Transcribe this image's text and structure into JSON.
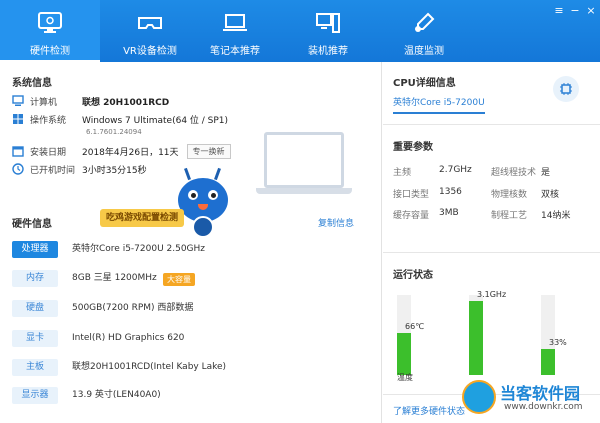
{
  "tabs": [
    {
      "label": "硬件检测",
      "icon": "monitor-icon"
    },
    {
      "label": "VR设备检测",
      "icon": "vr-headset-icon"
    },
    {
      "label": "笔记本推荐",
      "icon": "laptop-icon"
    },
    {
      "label": "装机推荐",
      "icon": "desktop-tower-icon"
    },
    {
      "label": "温度监测",
      "icon": "thermometer-icon"
    }
  ],
  "window": {
    "menu": "≡",
    "minimize": "−",
    "close": "×"
  },
  "system": {
    "title": "系统信息",
    "computer_label": "计算机",
    "computer_value": "联想 20H1001RCD",
    "os_label": "操作系统",
    "os_value": "Windows 7 Ultimate(64 位 / SP1)",
    "os_version": "6.1.7601.24094",
    "install_label": "安装日期",
    "install_value": "2018年4月26日，11天",
    "install_button": "专一换新",
    "uptime_label": "已开机时间",
    "uptime_value": "3小时35分15秒"
  },
  "banner": {
    "text": "吃鸡游戏配置检测"
  },
  "hardware": {
    "title": "硬件信息",
    "link": "复制信息",
    "items": [
      {
        "tag": "处理器",
        "value": "英特尔Core i5-7200U 2.50GHz",
        "badge": ""
      },
      {
        "tag": "内存",
        "value": "8GB 三星 1200MHz",
        "badge": "大容量"
      },
      {
        "tag": "硬盘",
        "value": "500GB(7200 RPM) 西部数据",
        "badge": ""
      },
      {
        "tag": "显卡",
        "value": "Intel(R) HD Graphics 620",
        "badge": ""
      },
      {
        "tag": "主板",
        "value": "联想20H1001RCD(Intel Kaby Lake)",
        "badge": ""
      },
      {
        "tag": "显示器",
        "value": "13.9 英寸(LEN40A0)",
        "badge": ""
      }
    ]
  },
  "cpu": {
    "title": "CPU详细信息",
    "tab": "英特尔Core i5-7200U",
    "params_title": "重要参数",
    "params": [
      {
        "k": "主频",
        "v": "2.7GHz",
        "k2": "超线程技术",
        "v2": "是"
      },
      {
        "k": "接口类型",
        "v": "1356",
        "k2": "物理核数",
        "v2": "双核"
      },
      {
        "k": "缓存容量",
        "v": "3MB",
        "k2": "制程工艺",
        "v2": "14纳米"
      }
    ]
  },
  "status": {
    "title": "运行状态",
    "bars": [
      {
        "label": "66℃",
        "fraction": 0.52
      },
      {
        "label": "3.1GHz",
        "fraction": 0.92
      },
      {
        "label": "33%",
        "fraction": 0.33
      }
    ],
    "bottom_label": "温度",
    "footer_link": "了解更多硬件状态"
  },
  "watermark": {
    "title": "当客软件园",
    "url": "www.downkr.com"
  },
  "colors": {
    "topbar": "#1477d8",
    "accent": "#1e87e0",
    "bar": "#3cbf2c",
    "badge": "#f5a623"
  }
}
